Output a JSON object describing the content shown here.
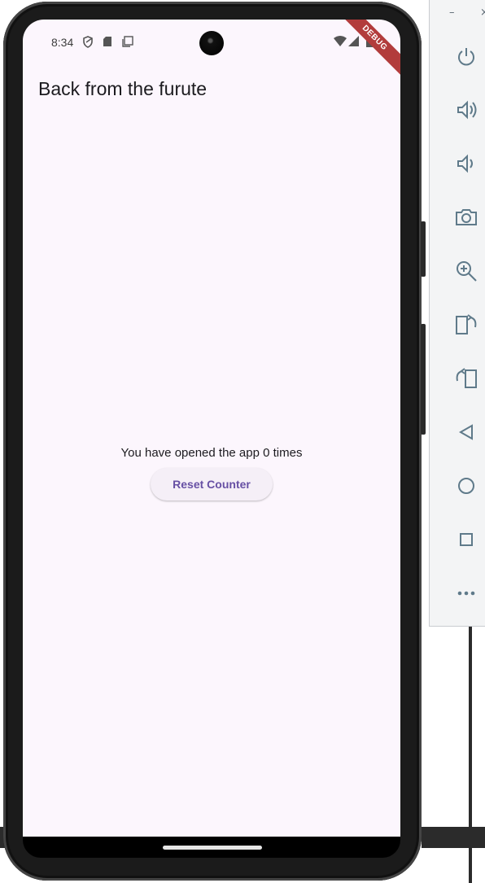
{
  "status_bar": {
    "time": "8:34"
  },
  "debug_banner": "DEBUG",
  "app_bar": {
    "title": "Back from the furute"
  },
  "main": {
    "counter_text": "You have opened the app 0 times",
    "reset_button_label": "Reset Counter"
  },
  "emulator_toolbar": {
    "minimize_label": "–",
    "close_label": "×",
    "buttons": [
      "power-icon",
      "volume-up-icon",
      "volume-down-icon",
      "camera-icon",
      "zoom-icon",
      "rotate-left-icon",
      "rotate-right-icon",
      "back-icon",
      "home-icon",
      "overview-icon",
      "more-icon"
    ]
  },
  "colors": {
    "screen_bg": "#fcf6fd",
    "button_text": "#6750a4",
    "button_bg": "#f5eff7",
    "debug_banner": "#b23c3c",
    "toolbar_icon": "#5f7a8a"
  }
}
